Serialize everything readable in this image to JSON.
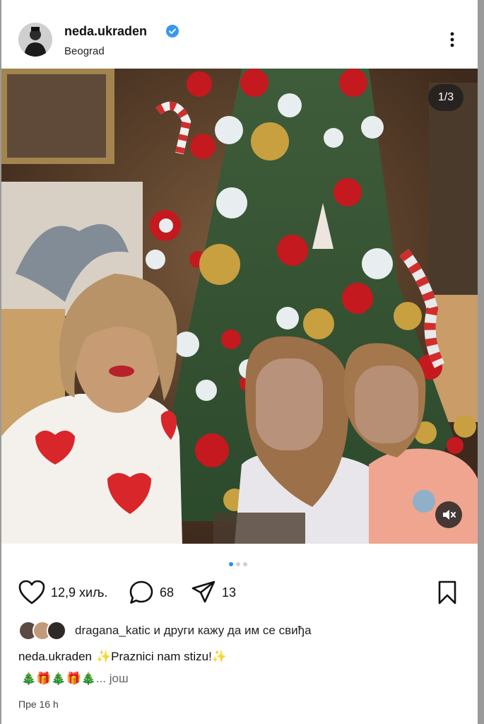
{
  "post": {
    "username": "neda.ukraden",
    "location": "Beograd",
    "verified": true,
    "slide_counter": "1/3",
    "slides_total": 3,
    "slide_active": 1
  },
  "actions": {
    "likes_count": "12,9 хиљ.",
    "comments_count": "68",
    "shares_count": "13"
  },
  "liked_by": {
    "user": "dragana_katic",
    "text": "и други кажу да им се свиђа"
  },
  "caption": {
    "username": "neda.ukraden",
    "text": "✨Praznici nam stizu!✨",
    "emoji_line": "🎄🎁🎄🎁🎄",
    "more_label": "... још"
  },
  "timestamp": "Пре 16 h",
  "colors": {
    "verified_blue": "#3897f0",
    "dot_active": "#2b8ff2",
    "heart_red": "#d8262b"
  },
  "icons": [
    "more-icon",
    "verified-icon",
    "heart-icon",
    "comment-icon",
    "share-icon",
    "bookmark-icon",
    "mute-icon"
  ]
}
